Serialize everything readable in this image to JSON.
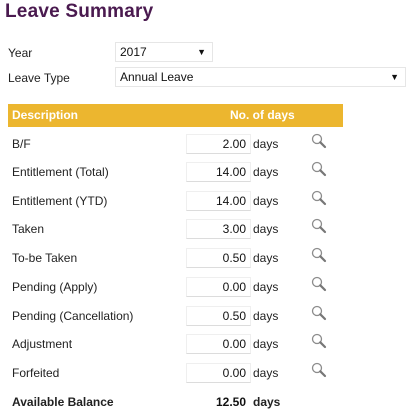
{
  "page": {
    "title": "Leave Summary"
  },
  "filters": {
    "year_label": "Year",
    "year_value": "2017",
    "leave_type_label": "Leave Type",
    "leave_type_value": "Annual Leave"
  },
  "table": {
    "header_description": "Description",
    "header_days": "No. of days",
    "unit": "days",
    "rows": [
      {
        "label": "B/F",
        "value": "2.00"
      },
      {
        "label": "Entitlement (Total)",
        "value": "14.00"
      },
      {
        "label": "Entitlement (YTD)",
        "value": "14.00"
      },
      {
        "label": "Taken",
        "value": "3.00"
      },
      {
        "label": "To-be Taken",
        "value": "0.50"
      },
      {
        "label": "Pending (Apply)",
        "value": "0.00"
      },
      {
        "label": "Pending (Cancellation)",
        "value": "0.50"
      },
      {
        "label": "Adjustment",
        "value": "0.00"
      },
      {
        "label": "Forfeited",
        "value": "0.00"
      }
    ],
    "total": {
      "label": "Available Balance",
      "value": "12.50"
    }
  },
  "colors": {
    "title": "#4a1a4f",
    "header_bg": "#ecb62f",
    "header_text": "#ffffff"
  },
  "icons": {
    "row_action": "search-icon",
    "dropdown": "caret-down-icon"
  }
}
